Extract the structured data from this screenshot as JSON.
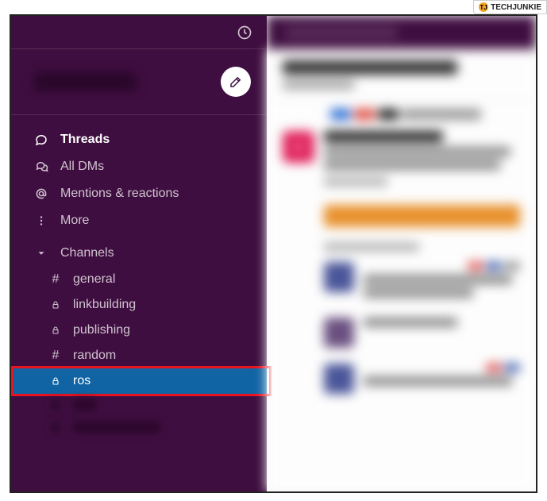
{
  "badge": {
    "text": "TECHJUNKIE",
    "icon_letter": "TJ"
  },
  "sidebar": {
    "nav": [
      {
        "label": "Threads",
        "icon": "threads-icon",
        "bold": true
      },
      {
        "label": "All DMs",
        "icon": "dm-icon",
        "bold": false
      },
      {
        "label": "Mentions & reactions",
        "icon": "mentions-icon",
        "bold": false
      },
      {
        "label": "More",
        "icon": "more-icon",
        "bold": false
      }
    ],
    "channels_header": "Channels",
    "channels": [
      {
        "name": "general",
        "type": "hash",
        "selected": false
      },
      {
        "name": "linkbuilding",
        "type": "lock",
        "selected": false
      },
      {
        "name": "publishing",
        "type": "lock",
        "selected": false
      },
      {
        "name": "random",
        "type": "hash",
        "selected": false
      },
      {
        "name": "ros",
        "type": "lock",
        "selected": true,
        "highlighted": true
      }
    ]
  }
}
